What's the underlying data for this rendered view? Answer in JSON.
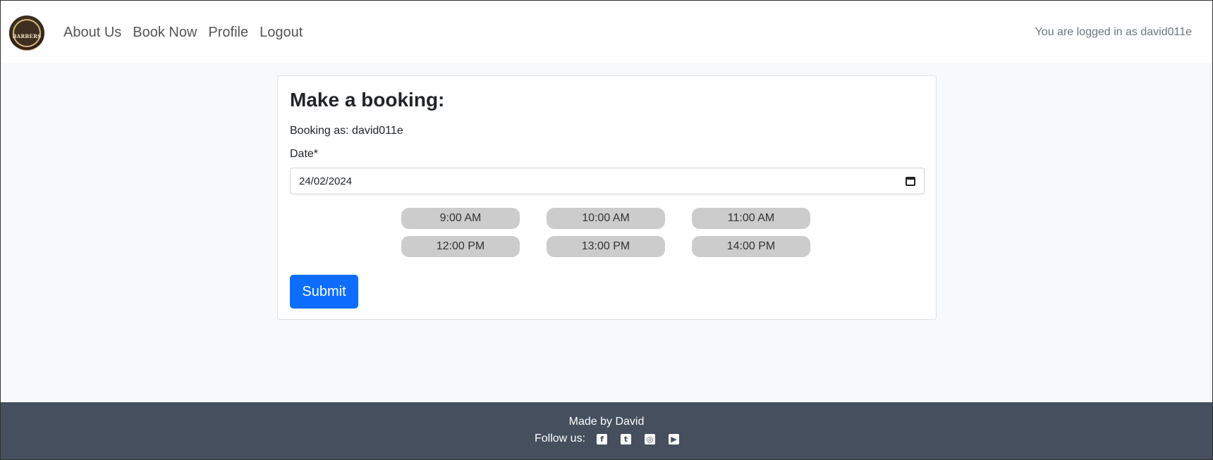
{
  "navbar": {
    "logo_text": "BARBERS",
    "links": [
      "About Us",
      "Book Now",
      "Profile",
      "Logout"
    ],
    "login_status": "You are logged in as david011e"
  },
  "booking": {
    "title": "Make a booking:",
    "booking_as": "Booking as: david011e",
    "date_label": "Date*",
    "date_value": "24/02/2024",
    "time_slots": [
      "9:00 AM",
      "10:00 AM",
      "11:00 AM",
      "12:00 PM",
      "13:00 PM",
      "14:00 PM"
    ],
    "submit_label": "Submit"
  },
  "footer": {
    "made_by": "Made by David",
    "follow_label": "Follow us:",
    "social_icons": [
      "facebook-icon",
      "twitter-icon",
      "instagram-icon",
      "youtube-icon"
    ]
  },
  "colors": {
    "primary": "#0d6efd",
    "footer_bg": "#454f5d",
    "slot_bg": "#cccccc",
    "page_bg": "#f8f9fa"
  }
}
